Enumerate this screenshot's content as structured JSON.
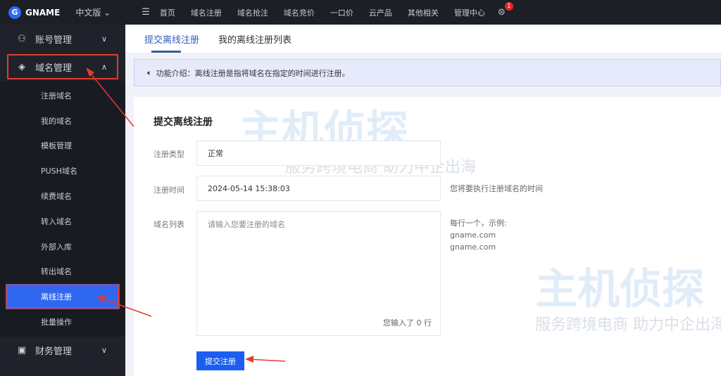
{
  "topbar": {
    "logo": "GNAME",
    "logo_letter": "G",
    "language": "中文版",
    "menu_icon": "☰",
    "nav": [
      "首页",
      "域名注册",
      "域名抢注",
      "域名竞价",
      "一口价",
      "云产品",
      "其他相关",
      "管理中心"
    ],
    "message_badge": "1"
  },
  "sidebar": {
    "groups": [
      {
        "label": "账号管理",
        "icon": "user-icon"
      },
      {
        "label": "域名管理",
        "icon": "layers-icon"
      },
      {
        "label": "财务管理",
        "icon": "finance-icon"
      }
    ],
    "sub_items": [
      "注册域名",
      "我的域名",
      "模板管理",
      "PUSH域名",
      "续费域名",
      "转入域名",
      "外部入库",
      "转出域名",
      "离线注册",
      "批量操作"
    ],
    "active": "离线注册"
  },
  "tabs": [
    {
      "label": "提交离线注册",
      "active": true
    },
    {
      "label": "我的离线注册列表",
      "active": false
    }
  ],
  "notice": "功能介绍：离线注册是指将域名在指定的时间进行注册。",
  "form": {
    "title": "提交离线注册",
    "type_label": "注册类型",
    "type_value": "正常",
    "time_label": "注册时间",
    "time_value": "2024-05-14 15:38:03",
    "time_hint": "您将要执行注册域名的时间",
    "list_label": "域名列表",
    "list_placeholder": "请输入您要注册的域名",
    "list_count": "您输入了 0 行",
    "list_hint": [
      "每行一个，示例:",
      "gname.com",
      "gname.com"
    ],
    "submit": "提交注册"
  },
  "watermark": {
    "brand": "主机侦探",
    "slogan": "服务跨境电商 助力中企出海"
  },
  "colors": {
    "accent": "#1c5ef0",
    "sidebar": "#1f222b",
    "highlight": "#e53a2f"
  }
}
